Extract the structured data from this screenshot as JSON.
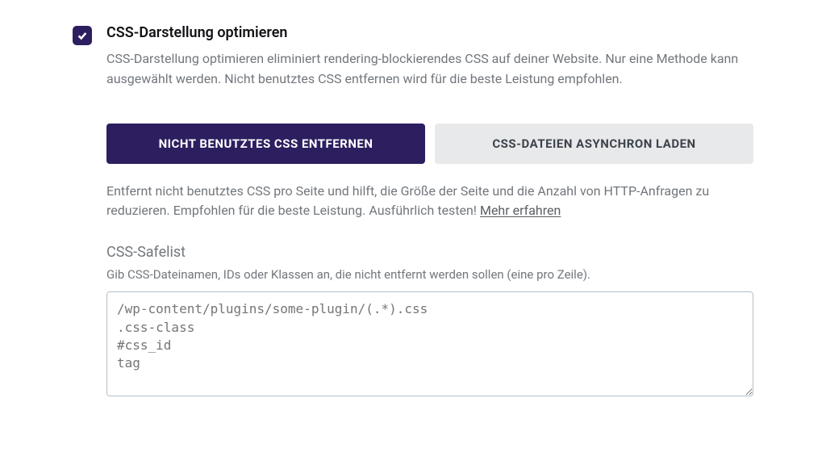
{
  "setting": {
    "title": "CSS-Darstellung optimieren",
    "description": "CSS-Darstellung optimieren eliminiert rendering-blockierendes CSS auf deiner Website. Nur eine Methode kann ausgewählt werden. Nicht benutztes CSS entfernen wird für die beste Leistung empfohlen."
  },
  "tabs": {
    "remove_unused": "NICHT BENUTZTES CSS ENTFERNEN",
    "async_load": "CSS-DATEIEN ASYNCHRON LADEN"
  },
  "tab_description": {
    "text": "Entfernt nicht benutztes CSS pro Seite und hilft, die Größe der Seite und die Anzahl von HTTP-Anfragen zu reduzieren. Empfohlen für die beste Leistung. Ausführlich testen! ",
    "link": "Mehr erfahren"
  },
  "safelist": {
    "label": "CSS-Safelist",
    "hint": "Gib CSS-Dateinamen, IDs oder Klassen an, die nicht entfernt werden sollen (eine pro Zeile).",
    "placeholder": "/wp-content/plugins/some-plugin/(.*).css\n.css-class\n#css_id\ntag"
  }
}
